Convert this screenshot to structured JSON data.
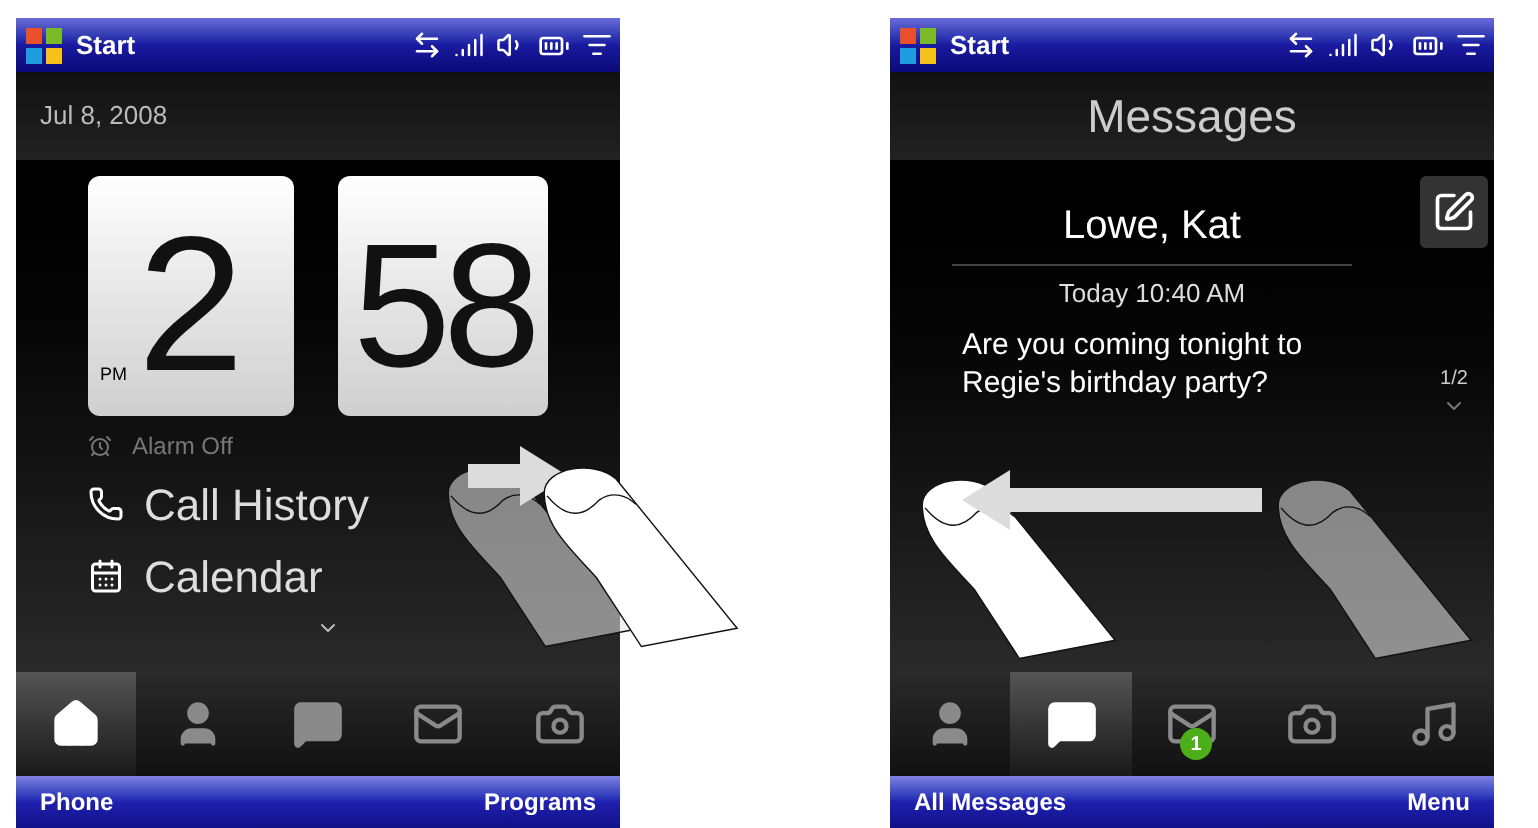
{
  "phones": [
    {
      "kind": "home",
      "title_bar": {
        "title": "Start"
      },
      "date": "Jul 8, 2008",
      "clock": {
        "hour": "2",
        "minute": "58",
        "meridiem": "PM"
      },
      "items": [
        {
          "kind": "alarm",
          "label": "Alarm Off"
        },
        {
          "kind": "call",
          "label": "Call History"
        },
        {
          "kind": "calendar",
          "label": "Calendar"
        }
      ],
      "tabs": [
        {
          "kind": "home",
          "selected": true
        },
        {
          "kind": "people",
          "selected": false
        },
        {
          "kind": "messages",
          "selected": false
        },
        {
          "kind": "mail",
          "selected": false
        },
        {
          "kind": "camera",
          "selected": false
        }
      ],
      "soft_keys": [
        "Phone",
        "Programs"
      ]
    },
    {
      "kind": "messages",
      "title_bar": {
        "title": "Start"
      },
      "header": "Messages",
      "message": {
        "sender": "Lowe, Kat",
        "time": "Today 10:40 AM",
        "body": "Are you coming tonight to Regie's birthday party?",
        "page": "1/2"
      },
      "tabs": [
        {
          "kind": "people",
          "selected": false
        },
        {
          "kind": "messages",
          "selected": true
        },
        {
          "kind": "mail",
          "selected": false,
          "badge": "1"
        },
        {
          "kind": "camera",
          "selected": false
        },
        {
          "kind": "music",
          "selected": false
        }
      ],
      "soft_keys": [
        "All Messages",
        "Menu"
      ]
    }
  ]
}
